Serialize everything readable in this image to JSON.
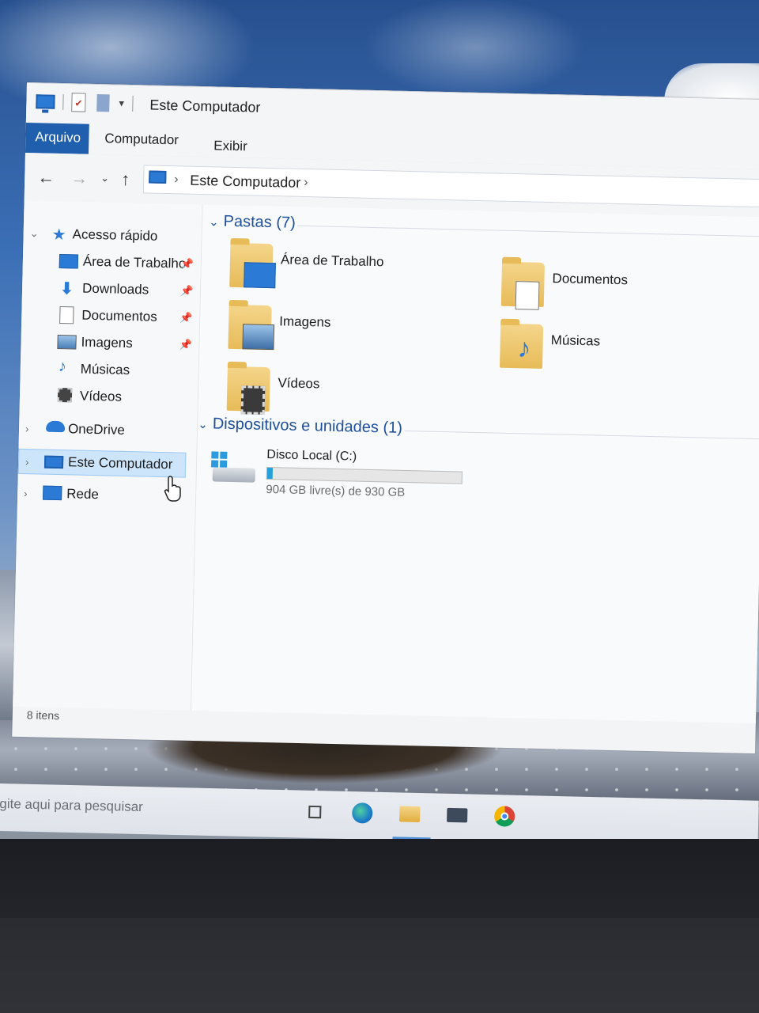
{
  "window": {
    "title": "Este Computador"
  },
  "ribbon": {
    "tabs": [
      "Arquivo",
      "Computador",
      "Exibir"
    ]
  },
  "address": {
    "path": "Este Computador"
  },
  "navpane": {
    "items": [
      {
        "label": "Acesso rápido",
        "icon": "star-icon",
        "pinned": false
      },
      {
        "label": "Área de Trabalho",
        "icon": "desktop-icon",
        "pinned": true
      },
      {
        "label": "Downloads",
        "icon": "download-icon",
        "pinned": true
      },
      {
        "label": "Documentos",
        "icon": "document-icon",
        "pinned": true
      },
      {
        "label": "Imagens",
        "icon": "picture-icon",
        "pinned": true
      },
      {
        "label": "Músicas",
        "icon": "music-icon",
        "pinned": false
      },
      {
        "label": "Vídeos",
        "icon": "video-icon",
        "pinned": false
      },
      {
        "label": "OneDrive",
        "icon": "cloud-icon",
        "pinned": false
      },
      {
        "label": "Este Computador",
        "icon": "computer-icon",
        "pinned": false,
        "selected": true
      },
      {
        "label": "Rede",
        "icon": "network-icon",
        "pinned": false
      }
    ]
  },
  "status": {
    "item_count": "8 itens"
  },
  "content": {
    "folders_header": "Pastas (7)",
    "folders": [
      {
        "name": "Área de Trabalho",
        "icon": "desktop-folder-icon"
      },
      {
        "name": "Documentos",
        "icon": "documents-folder-icon"
      },
      {
        "name": "Imagens",
        "icon": "pictures-folder-icon"
      },
      {
        "name": "Músicas",
        "icon": "music-folder-icon"
      },
      {
        "name": "Vídeos",
        "icon": "videos-folder-icon"
      }
    ],
    "devices_header": "Dispositivos e unidades (1)",
    "drive": {
      "name": "Disco Local (C:)",
      "free_text": "904 GB livre(s) de 930 GB",
      "used_fraction": 0.028
    }
  },
  "taskbar": {
    "search_placeholder": "gite aqui para pesquisar",
    "icons": [
      "task-view-icon",
      "edge-icon",
      "file-explorer-icon",
      "mail-icon",
      "chrome-icon"
    ]
  },
  "colors": {
    "accent": "#1f5fae",
    "header_blue": "#1e4f9c",
    "drive_bar": "#26a0da",
    "selection": "#cde5fb"
  }
}
